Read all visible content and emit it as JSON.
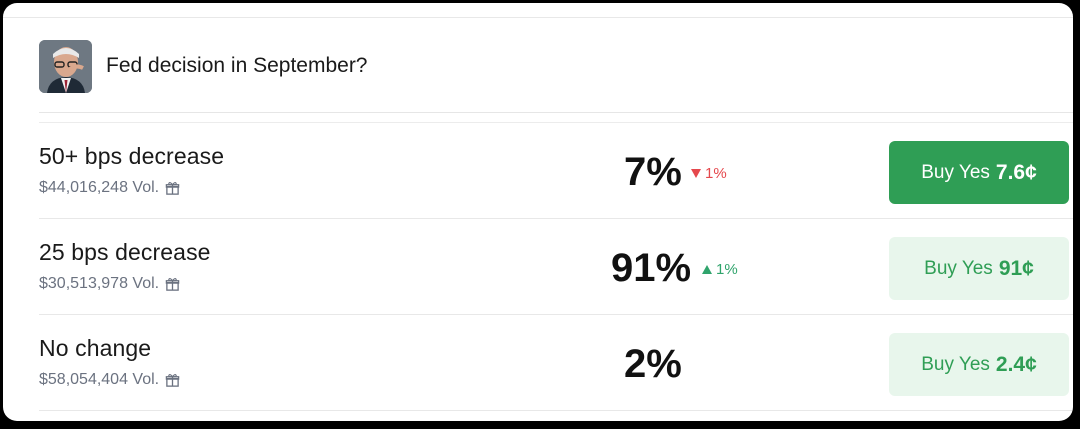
{
  "market": {
    "title": "Fed decision in September?",
    "avatar_icon": "person-portrait"
  },
  "outcomes": [
    {
      "label": "50+ bps decrease",
      "volume": "$44,016,248 Vol.",
      "probability": "7%",
      "change": "1%",
      "change_direction": "down",
      "buy_label": "Buy Yes",
      "buy_price": "7.6¢",
      "buy_style": "active"
    },
    {
      "label": "25 bps decrease",
      "volume": "$30,513,978 Vol.",
      "probability": "91%",
      "change": "1%",
      "change_direction": "up",
      "buy_label": "Buy Yes",
      "buy_price": "91¢",
      "buy_style": "inactive"
    },
    {
      "label": "No change",
      "volume": "$58,054,404 Vol.",
      "probability": "2%",
      "change": "",
      "change_direction": "none",
      "buy_label": "Buy Yes",
      "buy_price": "2.4¢",
      "buy_style": "inactive"
    }
  ],
  "colors": {
    "green": "#2f9e55",
    "green_light": "#e8f6ec",
    "red": "#e5484d",
    "muted": "#6b7280"
  }
}
